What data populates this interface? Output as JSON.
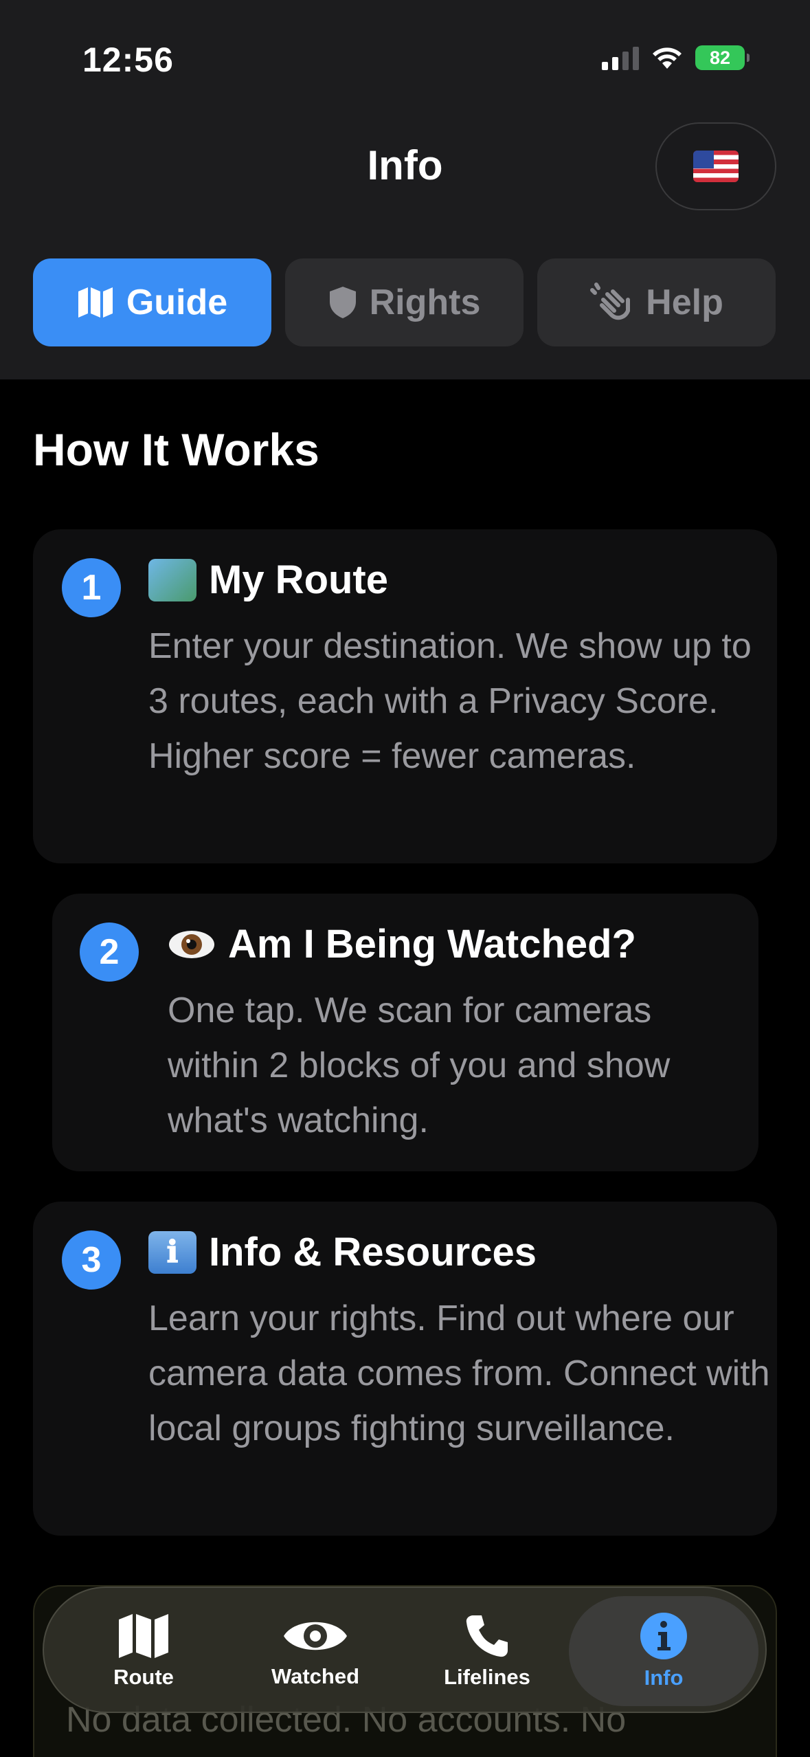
{
  "status_bar": {
    "time": "12:56",
    "battery": "82"
  },
  "header": {
    "title": "Info",
    "flag_icon": "us-flag-icon"
  },
  "tabs": [
    {
      "label": "Guide",
      "icon": "map-icon",
      "active": true
    },
    {
      "label": "Rights",
      "icon": "shield-icon",
      "active": false
    },
    {
      "label": "Help",
      "icon": "waving-hand-icon",
      "active": false
    }
  ],
  "section_title": "How It Works",
  "steps": [
    {
      "number": "1",
      "emoji": "🗺",
      "title": "My Route",
      "body": "Enter your destination. We show up to 3 routes, each with a Privacy Score. Higher score = fewer cameras."
    },
    {
      "number": "2",
      "emoji": "👁",
      "title": "Am I Being Watched?",
      "body": "One tap. We scan for cameras within 2 blocks of you and show what's watching."
    },
    {
      "number": "3",
      "emoji": "ℹ",
      "title": "Info & Resources",
      "body": "Learn your rights. Find out where our camera data comes from. Connect with local groups fighting surveillance."
    }
  ],
  "peek_card": {
    "text": "No data collected. No accounts. No"
  },
  "tab_bar": [
    {
      "label": "Route",
      "icon": "map-icon",
      "active": false
    },
    {
      "label": "Watched",
      "icon": "eye-icon",
      "active": false
    },
    {
      "label": "Lifelines",
      "icon": "phone-icon",
      "active": false
    },
    {
      "label": "Info",
      "icon": "info-icon",
      "active": true
    }
  ],
  "colors": {
    "accent": "#3a8ef5",
    "battery": "#34c759",
    "background": "#000000",
    "header_bg": "#1c1c1e"
  }
}
